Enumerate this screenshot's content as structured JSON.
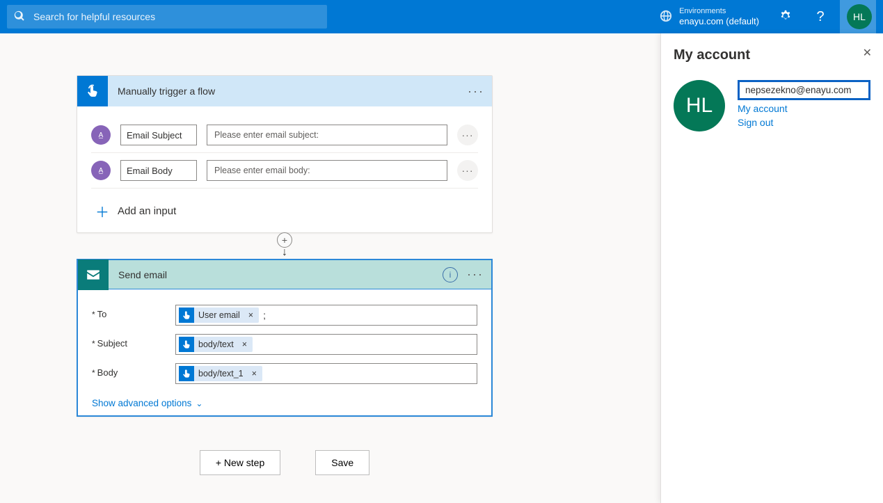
{
  "header": {
    "search_placeholder": "Search for helpful resources",
    "env_label": "Environments",
    "env_name": "enayu.com (default)",
    "avatar_initials": "HL"
  },
  "trigger_card": {
    "title": "Manually trigger a flow",
    "inputs": [
      {
        "label": "Email Subject",
        "placeholder": "Please enter email subject:"
      },
      {
        "label": "Email Body",
        "placeholder": "Please enter email body:"
      }
    ],
    "add_input_label": "Add an input"
  },
  "action_card": {
    "title": "Send email",
    "fields": {
      "to": {
        "label": "To",
        "token": "User email",
        "suffix": ";"
      },
      "subject": {
        "label": "Subject",
        "token": "body/text"
      },
      "body": {
        "label": "Body",
        "token": "body/text_1"
      }
    },
    "advanced_label": "Show advanced options"
  },
  "buttons": {
    "new_step": "+ New step",
    "save": "Save"
  },
  "panel": {
    "title": "My account",
    "avatar_initials": "HL",
    "email": "nepsezekno@enayu.com",
    "my_account_link": "My account",
    "sign_out": "Sign out"
  }
}
